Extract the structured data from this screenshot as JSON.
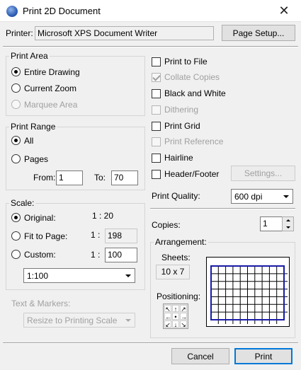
{
  "window": {
    "title": "Print 2D Document",
    "close_glyph": "✕"
  },
  "printer": {
    "label": "Printer:",
    "name": "Microsoft XPS Document Writer",
    "page_setup_label": "Page Setup..."
  },
  "print_area": {
    "legend": "Print Area",
    "options": [
      {
        "label": "Entire Drawing",
        "selected": true,
        "enabled": true
      },
      {
        "label": "Current Zoom",
        "selected": false,
        "enabled": true
      },
      {
        "label": "Marquee Area",
        "selected": false,
        "enabled": false
      }
    ]
  },
  "print_range": {
    "legend": "Print Range",
    "all_label": "All",
    "pages_label": "Pages",
    "from_label": "From:",
    "from_value": "1",
    "to_label": "To:",
    "to_value": "70"
  },
  "scale": {
    "legend": "Scale:",
    "original_label": "Original:",
    "original_value": "1 : 20",
    "fit_label": "Fit to Page:",
    "fit_prefix": "1 :",
    "fit_value": "198",
    "custom_label": "Custom:",
    "custom_prefix": "1 :",
    "custom_value": "100",
    "combo_value": "1:100"
  },
  "text_markers": {
    "label": "Text & Markers:",
    "value": "Resize to Printing Scale"
  },
  "options": {
    "print_to_file": "Print to File",
    "collate_copies": "Collate Copies",
    "black_and_white": "Black and White",
    "dithering": "Dithering",
    "print_grid": "Print Grid",
    "print_reference": "Print Reference",
    "hairline": "Hairline",
    "header_footer": "Header/Footer",
    "settings_label": "Settings..."
  },
  "quality": {
    "label": "Print Quality:",
    "value": "600 dpi"
  },
  "copies": {
    "label": "Copies:",
    "value": "1"
  },
  "arrangement": {
    "legend": "Arrangement:",
    "sheets_label": "Sheets:",
    "sheets_value": "10 x 7",
    "positioning_label": "Positioning:",
    "grid_cols": 10,
    "grid_rows": 7,
    "arrows": [
      "↖",
      "↑",
      "↗",
      "←",
      "•",
      "→",
      "↙",
      "↓",
      "↘"
    ]
  },
  "footer": {
    "cancel_label": "Cancel",
    "print_label": "Print"
  },
  "colors": {
    "accent": "#0078d7",
    "sheet_grid": "#1a1aa6"
  }
}
